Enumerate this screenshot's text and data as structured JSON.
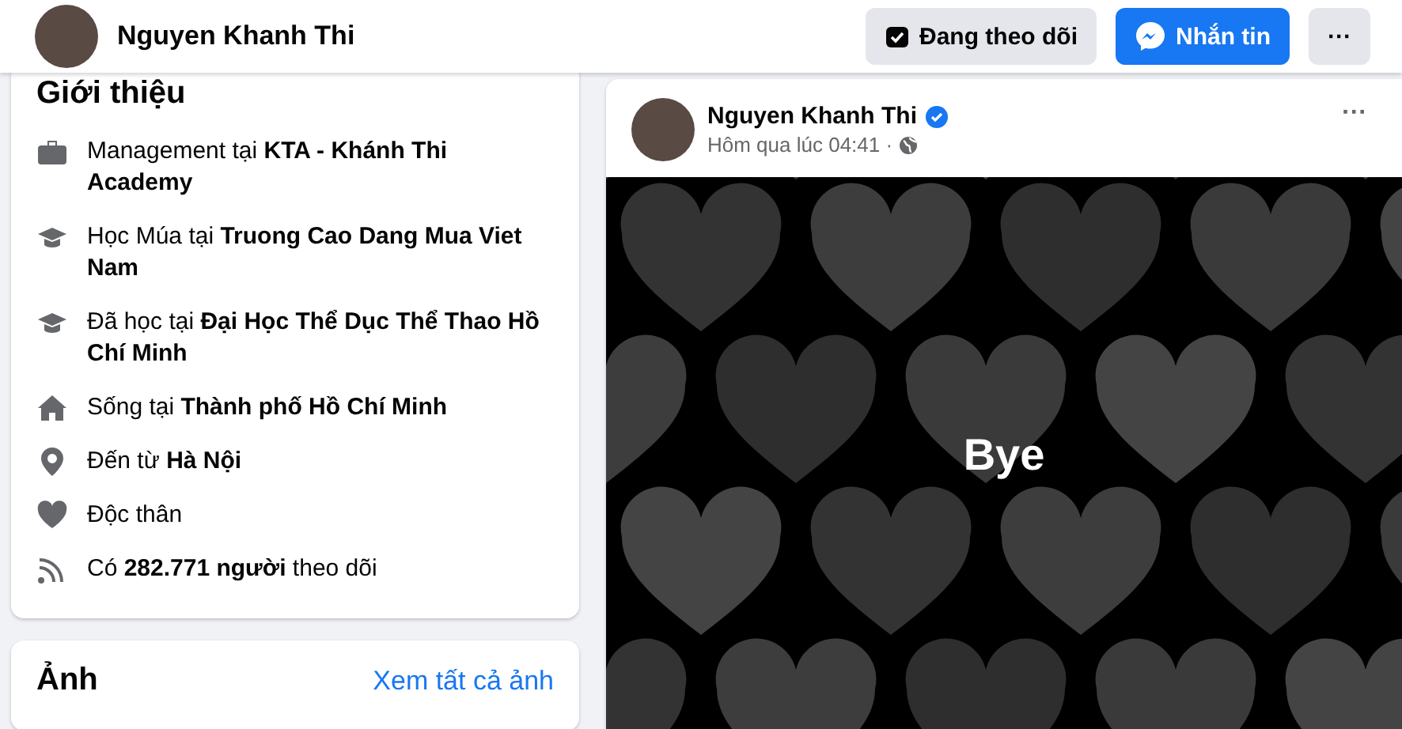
{
  "header": {
    "name": "Nguyen Khanh Thi",
    "buttons": [
      {
        "kind": "following",
        "label": "Đang theo dõi"
      },
      {
        "kind": "message",
        "label": "Nhắn tin"
      },
      {
        "kind": "more",
        "label": "···"
      }
    ]
  },
  "intro": {
    "title": "Giới thiệu",
    "items": [
      {
        "kind": "work",
        "text": "Management tại **KTA - Khánh Thi Academy**"
      },
      {
        "kind": "school",
        "text": "Học Múa tại **Truong Cao Dang Mua Viet Nam**"
      },
      {
        "kind": "school",
        "text": "Đã học tại **Đại Học Thể Dục Thể Thao Hồ Chí Minh**"
      },
      {
        "kind": "home",
        "text": "Sống tại **Thành phố Hồ Chí Minh**"
      },
      {
        "kind": "place",
        "text": "Đến từ **Hà Nội**"
      },
      {
        "kind": "heart",
        "text": "Độc thân"
      },
      {
        "kind": "feed",
        "text": "Có **282.771 người** theo dõi"
      }
    ]
  },
  "photos": {
    "title": "Ảnh",
    "link": "Xem tất cả ảnh"
  },
  "post": {
    "author": "Nguyen Khanh Thi",
    "verified": true,
    "time": "Hôm qua lúc 04:41 ·",
    "more": "···",
    "image_text": "Bye"
  }
}
